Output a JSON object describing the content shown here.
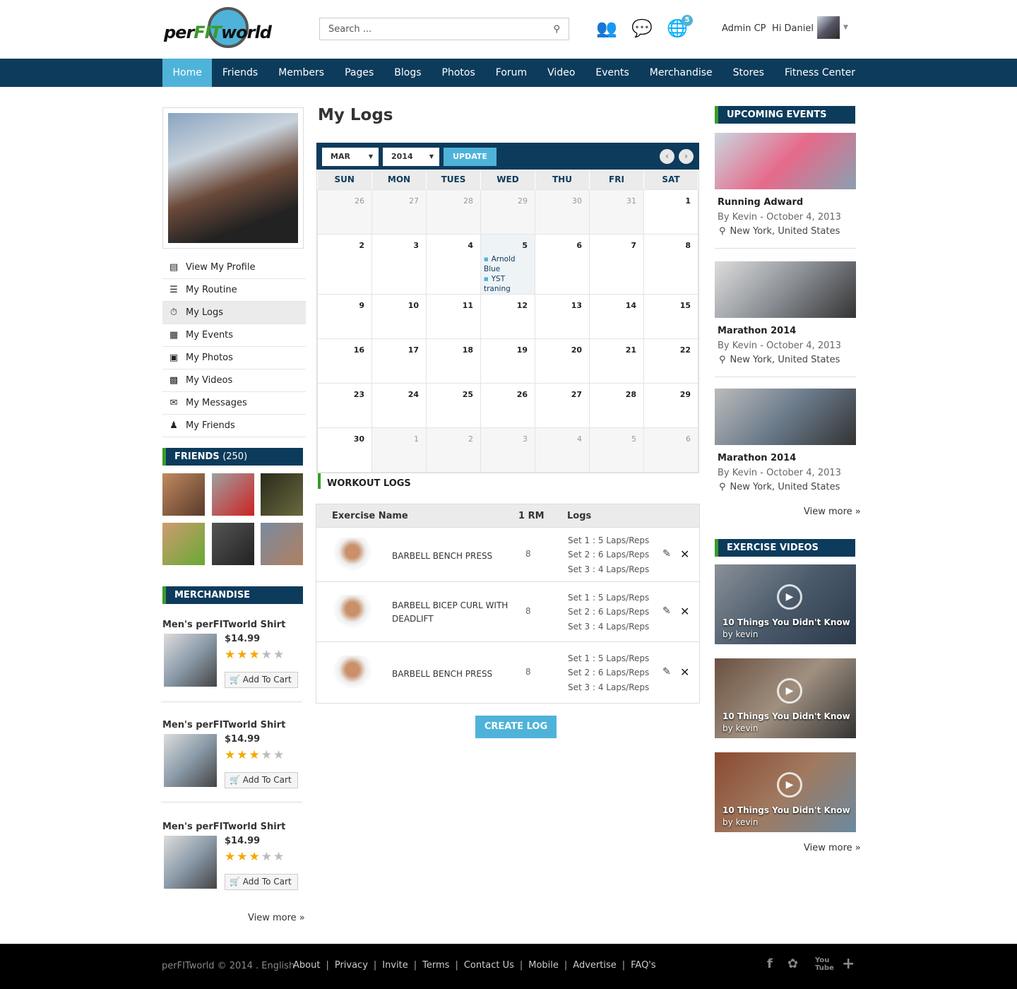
{
  "brand": {
    "name_pre": "per",
    "name_fit": "FIT",
    "name_post": "world"
  },
  "search": {
    "placeholder": "Search ..."
  },
  "header": {
    "notif_count": "5",
    "admin": "Admin CP",
    "greeting": "Hi Daniel"
  },
  "nav": [
    "Home",
    "Friends",
    "Members",
    "Pages",
    "Blogs",
    "Photos",
    "Forum",
    "Video",
    "Events",
    "Merchandise",
    "Stores",
    "Fitness Center"
  ],
  "sidebar": {
    "menu": [
      "View My Profile",
      "My Routine",
      "My Logs",
      "My Events",
      "My Photos",
      "My Videos",
      "My Messages",
      "My Friends"
    ],
    "friends_title": "FRIENDS",
    "friends_count": "(250)",
    "merch_title": "MERCHANDISE",
    "merch": [
      {
        "name": "Men's perFITworld Shirt",
        "price": "$14.99",
        "rating": 3,
        "cart": "Add To Cart"
      },
      {
        "name": "Men's perFITworld Shirt",
        "price": "$14.99",
        "rating": 3,
        "cart": "Add To Cart"
      },
      {
        "name": "Men's perFITworld Shirt",
        "price": "$14.99",
        "rating": 3,
        "cart": "Add To Cart"
      }
    ],
    "view_more": "View more"
  },
  "main": {
    "title": "My Logs",
    "month": "MAR",
    "year": "2014",
    "update": "UPDATE",
    "days": [
      "SUN",
      "MON",
      "TUES",
      "WED",
      "THU",
      "FRI",
      "SAT"
    ],
    "weeks": [
      [
        "26",
        "27",
        "28",
        "29",
        "30",
        "31",
        "1"
      ],
      [
        "2",
        "3",
        "4",
        "5",
        "6",
        "7",
        "8"
      ],
      [
        "9",
        "10",
        "11",
        "12",
        "13",
        "14",
        "15"
      ],
      [
        "16",
        "17",
        "18",
        "19",
        "20",
        "21",
        "22"
      ],
      [
        "23",
        "24",
        "25",
        "26",
        "27",
        "28",
        "29"
      ],
      [
        "30",
        "1",
        "2",
        "3",
        "4",
        "5",
        "6"
      ]
    ],
    "events": [
      "Arnold Blue",
      "YST traning"
    ],
    "workout_title": "WORKOUT LOGS",
    "cols": [
      "Exercise Name",
      "1 RM",
      "Logs"
    ],
    "logs": [
      {
        "name": "BARBELL BENCH PRESS",
        "rm": "8",
        "sets": [
          "Set 1 : 5 Laps/Reps",
          "Set 2 : 6 Laps/Reps",
          "Set 3 : 4 Laps/Reps"
        ]
      },
      {
        "name": "BARBELL BICEP CURL WITH DEADLIFT",
        "rm": "8",
        "sets": [
          "Set 1 : 5 Laps/Reps",
          "Set 2 : 6 Laps/Reps",
          "Set 3 : 4 Laps/Reps"
        ]
      },
      {
        "name": "BARBELL BENCH PRESS",
        "rm": "8",
        "sets": [
          "Set 1 : 5 Laps/Reps",
          "Set 2 : 6 Laps/Reps",
          "Set 3 : 4 Laps/Reps"
        ]
      }
    ],
    "create": "CREATE LOG"
  },
  "right": {
    "events_title": "UPCOMING EVENTS",
    "events": [
      {
        "title": "Running Adward",
        "by": "By Kevin  - October 4, 2013",
        "loc": "New York, United States"
      },
      {
        "title": "Marathon 2014",
        "by": "By Kevin  - October 4, 2013",
        "loc": "New York, United States"
      },
      {
        "title": "Marathon 2014",
        "by": "By Kevin  - October 4, 2013",
        "loc": "New York, United States"
      }
    ],
    "view_more": "View more",
    "videos_title": "EXERCISE VIDEOS",
    "videos": [
      {
        "title": "10 Things You Didn't Know",
        "by": "by kevin"
      },
      {
        "title": "10 Things You Didn't Know",
        "by": "by kevin"
      },
      {
        "title": "10 Things You Didn't Know",
        "by": "by kevin"
      }
    ]
  },
  "footer": {
    "copy": "perFITworld © 2014 . English",
    "links": [
      "About",
      "Privacy",
      "Invite",
      "Terms",
      "Contact Us",
      "Mobile",
      "Advertise",
      "FAQ's"
    ]
  },
  "colors": {
    "navy": "#0d3b5c",
    "accent": "#4fb3d9",
    "green": "#3a9a2a"
  }
}
